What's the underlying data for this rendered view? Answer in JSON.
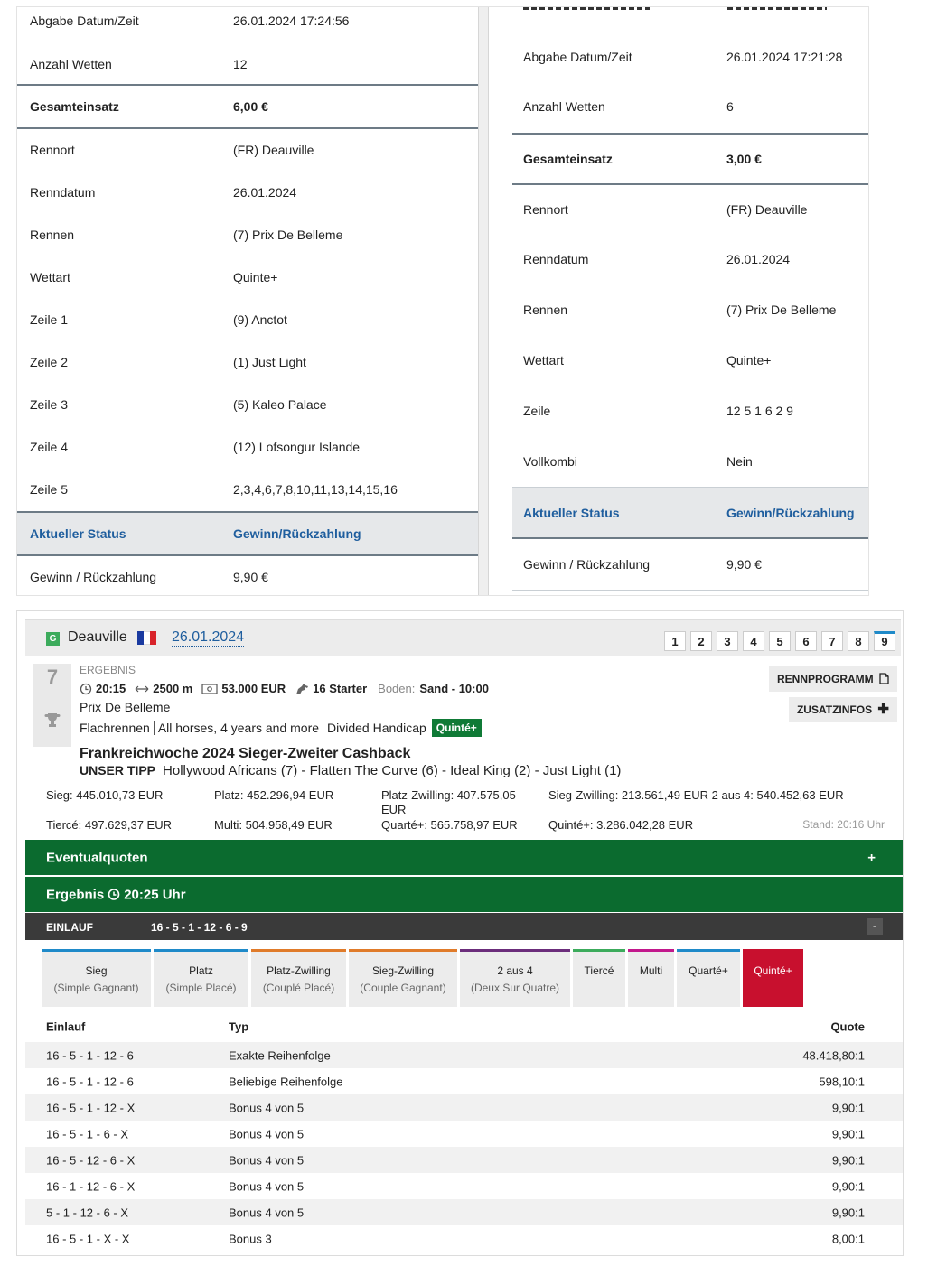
{
  "receipt_left": {
    "rows": [
      {
        "label": "Abgabe Datum/Zeit",
        "value": "26.01.2024 17:24:56"
      },
      {
        "label": "Anzahl Wetten",
        "value": "12"
      },
      {
        "label": "Gesamteinsatz",
        "value": "6,00 €"
      },
      {
        "label": "Rennort",
        "value": "(FR) Deauville"
      },
      {
        "label": "Renndatum",
        "value": "26.01.2024"
      },
      {
        "label": "Rennen",
        "value": "(7) Prix De Belleme"
      },
      {
        "label": "Wettart",
        "value": "Quinte+"
      },
      {
        "label": "Zeile 1",
        "value": "(9) Anctot"
      },
      {
        "label": "Zeile 2",
        "value": "(1) Just Light"
      },
      {
        "label": "Zeile 3",
        "value": "(5) Kaleo Palace"
      },
      {
        "label": "Zeile 4",
        "value": "(12) Lofsongur Islande"
      },
      {
        "label": "Zeile 5",
        "value": "2,3,4,6,7,8,10,11,13,14,15,16"
      },
      {
        "label": "Aktueller Status",
        "value": "Gewinn/Rückzahlung"
      },
      {
        "label": "Gewinn / Rückzahlung",
        "value": "9,90 €"
      }
    ]
  },
  "receipt_right": {
    "rows": [
      {
        "label": "Abgabe Datum/Zeit",
        "value": "26.01.2024 17:21:28"
      },
      {
        "label": "Anzahl Wetten",
        "value": "6"
      },
      {
        "label": "Gesamteinsatz",
        "value": "3,00 €"
      },
      {
        "label": "Rennort",
        "value": "(FR) Deauville"
      },
      {
        "label": "Renndatum",
        "value": "26.01.2024"
      },
      {
        "label": "Rennen",
        "value": "(7) Prix De Belleme"
      },
      {
        "label": "Wettart",
        "value": "Quinte+"
      },
      {
        "label": "Zeile",
        "value": "12 5 1 6 2 9"
      },
      {
        "label": "Vollkombi",
        "value": "Nein"
      },
      {
        "label": "Aktueller Status",
        "value": "Gewinn/Rückzahlung"
      },
      {
        "label": "Gewinn / Rückzahlung",
        "value": "9,90 €"
      }
    ]
  },
  "race": {
    "badge": "G",
    "venue": "Deauville",
    "date": "26.01.2024",
    "race_numbers": [
      "1",
      "2",
      "3",
      "4",
      "5",
      "6",
      "7",
      "8",
      "9"
    ],
    "active_race": "9",
    "race_no": "7",
    "status": "ERGEBNIS",
    "time": "20:15",
    "distance": "2500 m",
    "prize": "53.000 EUR",
    "starters": "16 Starter",
    "ground_label": "Boden:",
    "ground": "Sand - 10:00",
    "name": "Prix De Belleme",
    "tags": [
      "Flachrennen",
      "All horses, 4 years and more",
      "Divided Handicap"
    ],
    "bet_tag": "Quinté+",
    "btn_program": "RENNPROGRAMM",
    "btn_info": "ZUSATZINFOS",
    "cashback": "Frankreichwoche 2024 Sieger-Zweiter Cashback",
    "tipp_label": "UNSER TIPP",
    "tipp": "Hollywood Africans (7) - Flatten The Curve (6) - Ideal King (2) - Just Light (1)",
    "pools": {
      "sieg": "Sieg: 445.010,73 EUR",
      "platz": "Platz: 452.296,94 EUR",
      "platz_zwilling": "Platz-Zwilling: 407.575,05 EUR",
      "sieg_zwilling": "Sieg-Zwilling: 213.561,49 EUR 2 aus 4: 540.452,63 EUR",
      "tierce": "Tiercé: 497.629,37 EUR",
      "multi": "Multi: 504.958,49 EUR",
      "quarte": "Quarté+: 565.758,97 EUR",
      "quinte": "Quinté+: 3.286.042,28 EUR"
    },
    "stand": "Stand: 20:16 Uhr",
    "eventualquoten": "Eventualquoten",
    "ergebnis": "Ergebnis",
    "ergebnis_time": "20:25 Uhr",
    "einlauf_label": "EINLAUF",
    "einlauf": "16 - 5 - 1 - 12 - 6 - 9",
    "bet_tabs": [
      {
        "name": "Sieg",
        "sub": "(Simple Gagnant)",
        "color": "#1f8ac9"
      },
      {
        "name": "Platz",
        "sub": "(Simple Placé)",
        "color": "#1f8ac9"
      },
      {
        "name": "Platz-Zwilling",
        "sub": "(Couplé Placé)",
        "color": "#e07b2a"
      },
      {
        "name": "Sieg-Zwilling",
        "sub": "(Couple Gagnant)",
        "color": "#e07b2a"
      },
      {
        "name": "2 aus 4",
        "sub": "(Deux Sur Quatre)",
        "color": "#6b2d7b"
      },
      {
        "name": "Tiercé",
        "sub": "",
        "color": "#3cab5c"
      },
      {
        "name": "Multi",
        "sub": "",
        "color": "#c2188c"
      },
      {
        "name": "Quarté+",
        "sub": "",
        "color": "#1f8ac9"
      },
      {
        "name": "Quinté+",
        "sub": "",
        "color": "#c8102e"
      }
    ],
    "quote_headers": {
      "einlauf": "Einlauf",
      "typ": "Typ",
      "quote": "Quote"
    },
    "quotes": [
      {
        "einlauf": "16 - 5 - 1 - 12 - 6",
        "typ": "Exakte Reihenfolge",
        "quote": "48.418,80:1"
      },
      {
        "einlauf": "16 - 5 - 1 - 12 - 6",
        "typ": "Beliebige Reihenfolge",
        "quote": "598,10:1"
      },
      {
        "einlauf": "16 - 5 - 1 - 12 - X",
        "typ": "Bonus 4 von 5",
        "quote": "9,90:1"
      },
      {
        "einlauf": "16 - 5 - 1 - 6 - X",
        "typ": "Bonus 4 von 5",
        "quote": "9,90:1"
      },
      {
        "einlauf": "16 - 5 - 12 - 6 - X",
        "typ": "Bonus 4 von 5",
        "quote": "9,90:1"
      },
      {
        "einlauf": "16 - 1 - 12 - 6 - X",
        "typ": "Bonus 4 von 5",
        "quote": "9,90:1"
      },
      {
        "einlauf": "5 - 1 - 12 - 6 - X",
        "typ": "Bonus 4 von 5",
        "quote": "9,90:1"
      },
      {
        "einlauf": "16 - 5 - 1 - X - X",
        "typ": "Bonus 3",
        "quote": "8,00:1"
      }
    ]
  }
}
